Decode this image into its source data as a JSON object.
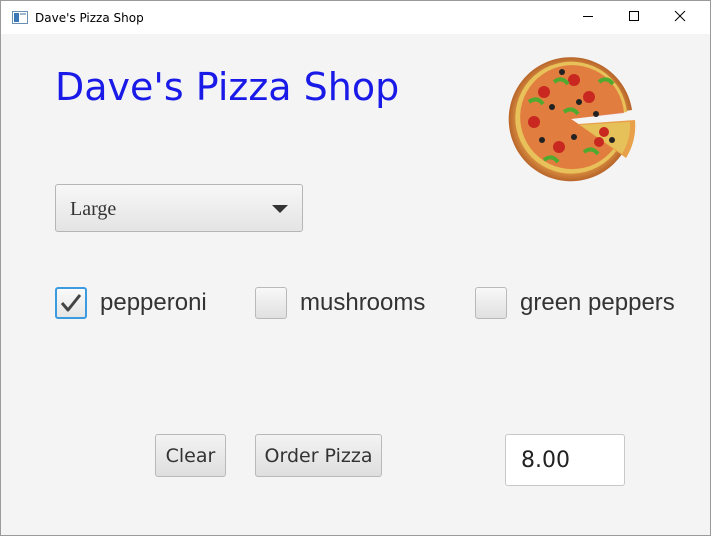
{
  "window": {
    "title": "Dave's Pizza Shop",
    "icon": "java-app-icon",
    "controls": [
      "minimize-icon",
      "maximize-icon",
      "close-icon"
    ]
  },
  "header": {
    "title": "Dave's Pizza Shop",
    "title_color": "#1a1ae8",
    "image": "pizza-image"
  },
  "size_select": {
    "selected": "Large"
  },
  "toppings": [
    {
      "label": "pepperoni",
      "checked": true
    },
    {
      "label": "mushrooms",
      "checked": false
    },
    {
      "label": "green peppers",
      "checked": false
    }
  ],
  "actions": {
    "clear_label": "Clear",
    "order_label": "Order Pizza"
  },
  "total": {
    "value": "8.00"
  },
  "colors": {
    "focus_accent": "#3b9be0",
    "background": "#f4f4f4"
  }
}
